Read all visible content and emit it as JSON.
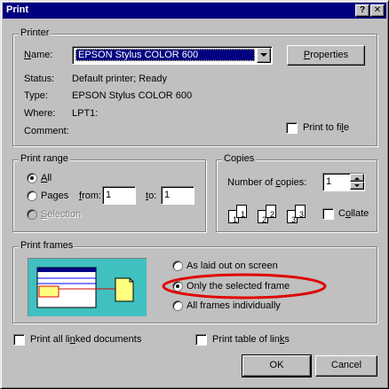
{
  "window": {
    "title": "Print"
  },
  "titlebar": {
    "help_glyph": "?",
    "close_glyph": "✕"
  },
  "printer": {
    "group_label": "Printer",
    "name_label": "Name:",
    "name_value": "EPSON Stylus COLOR 600",
    "properties_label": "Properties",
    "status_label": "Status:",
    "status_value": "Default printer; Ready",
    "type_label": "Type:",
    "type_value": "EPSON Stylus COLOR 600",
    "where_label": "Where:",
    "where_value": "LPT1:",
    "comment_label": "Comment:",
    "comment_value": "",
    "print_to_file_label": "Print to file",
    "print_to_file_checked": false
  },
  "print_range": {
    "group_label": "Print range",
    "all_label": "All",
    "pages_label": "Pages",
    "from_label": "from:",
    "from_value": "1",
    "to_label": "to:",
    "to_value": "1",
    "selection_label": "Selection",
    "selected": "All"
  },
  "copies": {
    "group_label": "Copies",
    "number_label": "Number of copies:",
    "number_value": "1",
    "collate_label": "Collate",
    "collate_checked": false,
    "page_labels": [
      "1",
      "1",
      "2",
      "2",
      "3",
      "3"
    ]
  },
  "print_frames": {
    "group_label": "Print frames",
    "options": [
      "As laid out on screen",
      "Only the selected frame",
      "All frames individually"
    ],
    "selected": "Only the selected frame",
    "highlight_color": "#e00000"
  },
  "print_linked_label": "Print all linked documents",
  "print_table_label": "Print table of links",
  "ok_label": "OK",
  "cancel_label": "Cancel",
  "colors": {
    "title_bar": "#000080",
    "face": "#c0c0c0",
    "selection": "#000080",
    "preview_bg": "#40c0c0"
  }
}
